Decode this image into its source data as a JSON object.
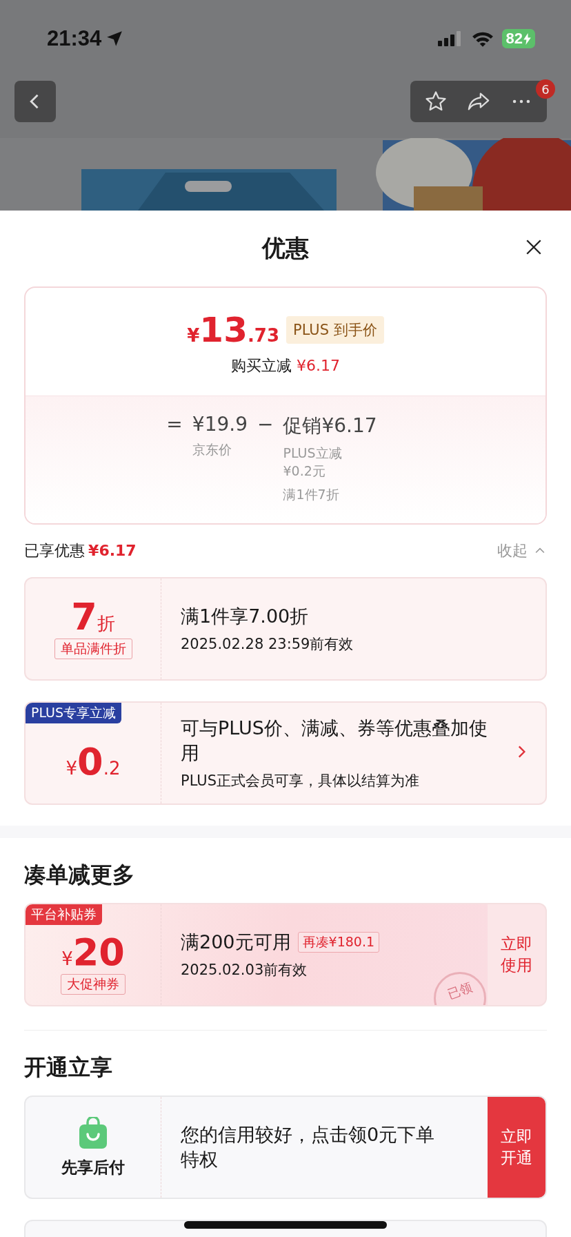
{
  "status_bar": {
    "time": "21:34",
    "battery": "82",
    "charging": true
  },
  "nav": {
    "badge": "6"
  },
  "sheet": {
    "title": "优惠"
  },
  "price_card": {
    "currency": "¥",
    "price_int": "13",
    "price_dec": ".73",
    "tag": "PLUS 到手价",
    "reduce_label": "购买立减",
    "reduce_value": "¥6.17",
    "equals": "=",
    "base_price": "¥19.9",
    "base_label": "京东价",
    "minus": "−",
    "promo": "促销¥6.17",
    "promo_details": [
      "PLUS立减 ¥0.2元",
      "满1件7折"
    ]
  },
  "enjoyed": {
    "label": "已享优惠",
    "value": "¥6.17",
    "toggle": "收起",
    "expanded": true
  },
  "discounts": [
    {
      "kind": "discount",
      "big": "7",
      "unit": "折",
      "tag": "单品满件折",
      "title": "满1件享7.00折",
      "sub": "2025.02.28 23:59前有效",
      "arrow": false
    },
    {
      "kind": "plus",
      "ribbon": "PLUS专享立减",
      "currency": "¥",
      "big": "0",
      "unit": ".2",
      "title": "可与PLUS价、满减、券等优惠叠加使用",
      "sub": "PLUS正式会员可享，具体以结算为准",
      "arrow": true
    }
  ],
  "more_section": {
    "title": "凑单减更多",
    "coupons": [
      {
        "ribbon": "平台补贴券",
        "currency": "¥",
        "amount": "20",
        "tag": "大促神券",
        "title": "满200元可用",
        "extra": "再凑¥180.1",
        "sub": "2025.02.03前有效",
        "action": "立即使用",
        "stamp": "已领"
      }
    ]
  },
  "open_section": {
    "title": "开通立享",
    "offers": [
      {
        "label": "先享后付",
        "text": "您的信用较好，点击领0元下单特权",
        "action": "立即开通"
      }
    ]
  }
}
